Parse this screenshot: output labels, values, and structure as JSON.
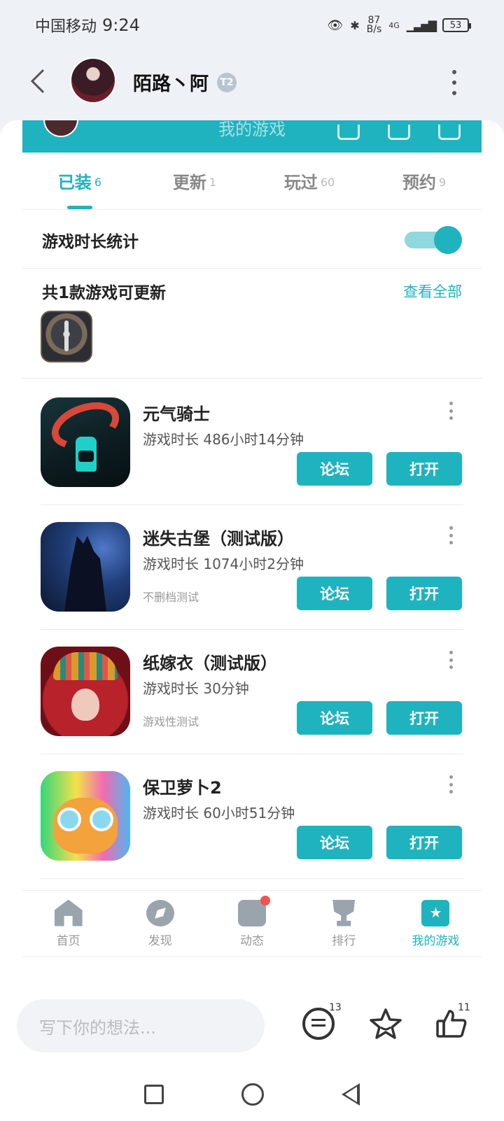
{
  "status_bar": {
    "carrier": "中国移动",
    "time": "9:24",
    "net_speed_value": "87",
    "net_speed_unit": "B/s",
    "network": "4G",
    "battery": "53"
  },
  "header": {
    "username": "陌路丶阿",
    "badge": "T2"
  },
  "banner": {
    "title_partial": "我的游戏"
  },
  "tabs": [
    {
      "label": "已装",
      "count": "6",
      "active": true
    },
    {
      "label": "更新",
      "count": "1",
      "active": false
    },
    {
      "label": "玩过",
      "count": "60",
      "active": false
    },
    {
      "label": "预约",
      "count": "9",
      "active": false
    }
  ],
  "stats": {
    "label": "游戏时长统计",
    "toggle_on": true
  },
  "update_section": {
    "title": "共1款游戏可更新",
    "view_all": "查看全部"
  },
  "games": [
    {
      "name": "元气骑士",
      "playtime": "游戏时长 486小时14分钟",
      "note": "",
      "forum": "论坛",
      "open": "打开"
    },
    {
      "name": "迷失古堡（测试版）",
      "playtime": "游戏时长 1074小时2分钟",
      "note": "不删档测试",
      "forum": "论坛",
      "open": "打开"
    },
    {
      "name": "纸嫁衣（测试版）",
      "playtime": "游戏时长 30分钟",
      "note": "游戏性测试",
      "forum": "论坛",
      "open": "打开"
    },
    {
      "name": "保卫萝卜2",
      "playtime": "游戏时长 60小时51分钟",
      "note": "",
      "forum": "论坛",
      "open": "打开"
    }
  ],
  "bottom_nav": [
    {
      "label": "首页",
      "icon": "home-icon"
    },
    {
      "label": "发现",
      "icon": "compass-icon"
    },
    {
      "label": "动态",
      "icon": "feed-icon"
    },
    {
      "label": "排行",
      "icon": "trophy-icon"
    },
    {
      "label": "我的游戏",
      "icon": "my-games-icon",
      "active": true
    }
  ],
  "comment_bar": {
    "placeholder": "写下你的想法...",
    "comment_count": "13",
    "like_count": "11"
  },
  "colors": {
    "accent": "#1fb3bf",
    "badge_red": "#f2534d"
  }
}
